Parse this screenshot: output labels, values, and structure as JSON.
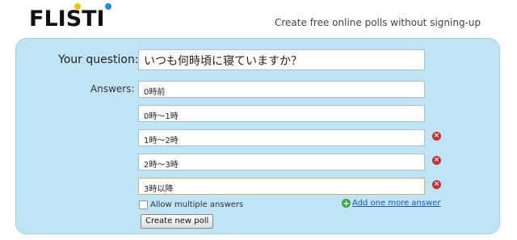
{
  "header": {
    "logo_text": "FLISTI",
    "tagline": "Create free online polls without signing-up"
  },
  "form": {
    "question_label": "Your question:",
    "question_value": "いつも何時頃に寝ていますか？",
    "answers_label": "Answers:",
    "answers": [
      {
        "value": "0時前"
      },
      {
        "value": "0時～1時"
      },
      {
        "value": "1時～2時"
      },
      {
        "value": "2時～3時"
      },
      {
        "value": "3時以降"
      }
    ],
    "remove_icon": "remove-icon",
    "allow_multiple_label": "Allow multiple answers",
    "allow_multiple_checked": false,
    "add_answer_label": "Add one more answer",
    "create_button_label": "Create new poll"
  },
  "colors": {
    "panel_bg": "#bfe4f6",
    "link": "#1f56c5",
    "remove": "#d12b2b",
    "add": "#3aa53a"
  }
}
